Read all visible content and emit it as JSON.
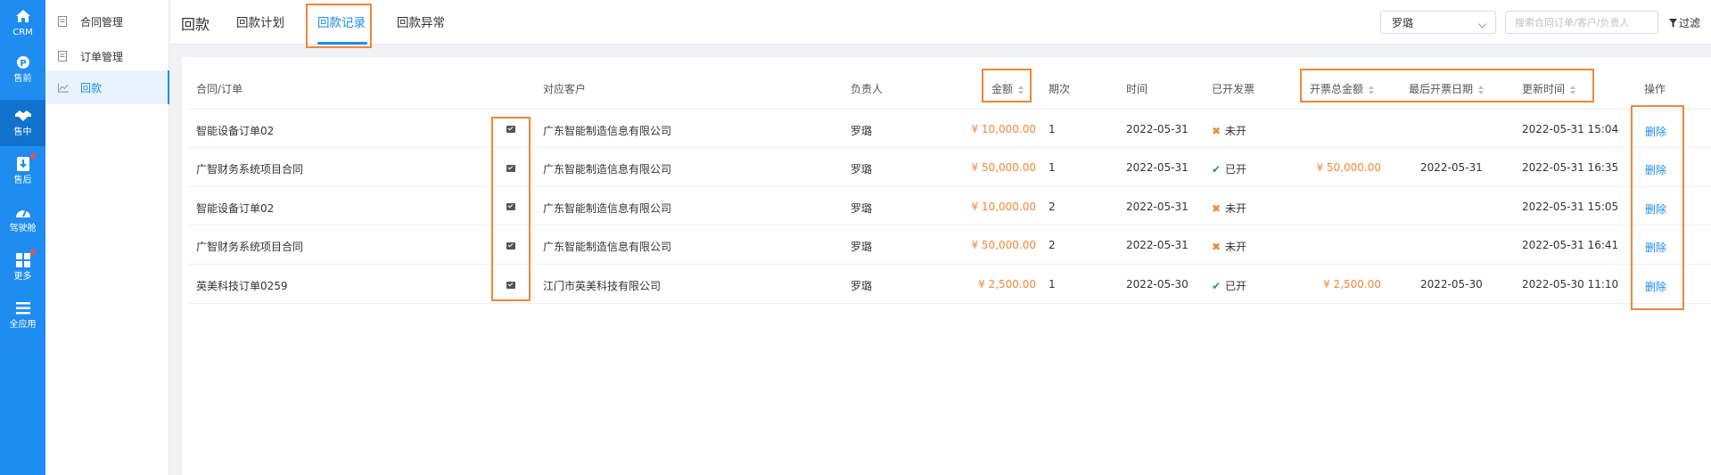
{
  "rail": [
    {
      "icon": "home-icon",
      "label": "CRM"
    },
    {
      "icon": "presale-icon",
      "label": "售前"
    },
    {
      "icon": "handshake-icon",
      "label": "售中"
    },
    {
      "icon": "aftersale-icon",
      "label": "售后"
    },
    {
      "icon": "dashboard-icon",
      "label": "驾驶舱"
    },
    {
      "icon": "grid-icon",
      "label": "更多"
    },
    {
      "icon": "menu-icon",
      "label": "全应用"
    }
  ],
  "submenu": [
    {
      "icon": "document-icon",
      "label": "合同管理"
    },
    {
      "icon": "document-icon",
      "label": "订单管理"
    },
    {
      "icon": "chart-line-icon",
      "label": "回款"
    }
  ],
  "header": {
    "title": "回款",
    "tabs": [
      "回款计划",
      "回款记录",
      "回款异常"
    ],
    "active_tab": "回款记录",
    "owner_select": "罗璐",
    "search_placeholder": "搜索合同订单/客户/负责人",
    "filter_label": "过滤"
  },
  "table": {
    "columns": {
      "contract": "合同/订单",
      "customer": "对应客户",
      "owner": "负责人",
      "amount": "金额",
      "period": "期次",
      "time": "时间",
      "invoiced": "已开发票",
      "invoice_total": "开票总金额",
      "last_invoice_date": "最后开票日期",
      "updated": "更新时间",
      "action": "操作"
    },
    "rows": [
      {
        "contract": "智能设备订单02",
        "customer": "广东智能制造信息有限公司",
        "owner": "罗璐",
        "amount": "¥ 10,000.00",
        "period": "1",
        "time": "2022-05-31",
        "invoiced": "未开",
        "invoice_total": "",
        "last_invoice_date": "",
        "updated": "2022-05-31 15:04",
        "action": "删除"
      },
      {
        "contract": "广智财务系统项目合同",
        "customer": "广东智能制造信息有限公司",
        "owner": "罗璐",
        "amount": "¥ 50,000.00",
        "period": "1",
        "time": "2022-05-31",
        "invoiced": "已开",
        "invoice_total": "¥ 50,000.00",
        "last_invoice_date": "2022-05-31",
        "updated": "2022-05-31 16:35",
        "action": "删除"
      },
      {
        "contract": "智能设备订单02",
        "customer": "广东智能制造信息有限公司",
        "owner": "罗璐",
        "amount": "¥ 10,000.00",
        "period": "2",
        "time": "2022-05-31",
        "invoiced": "未开",
        "invoice_total": "",
        "last_invoice_date": "",
        "updated": "2022-05-31 15:05",
        "action": "删除"
      },
      {
        "contract": "广智财务系统项目合同",
        "customer": "广东智能制造信息有限公司",
        "owner": "罗璐",
        "amount": "¥ 50,000.00",
        "period": "2",
        "time": "2022-05-31",
        "invoiced": "未开",
        "invoice_total": "",
        "last_invoice_date": "",
        "updated": "2022-05-31 16:41",
        "action": "删除"
      },
      {
        "contract": "英美科技订单0259",
        "customer": "江门市英美科技有限公司",
        "owner": "罗璐",
        "amount": "¥ 2,500.00",
        "period": "1",
        "time": "2022-05-30",
        "invoiced": "已开",
        "invoice_total": "¥ 2,500.00",
        "last_invoice_date": "2022-05-30",
        "updated": "2022-05-30 11:10",
        "action": "删除"
      }
    ]
  },
  "colors": {
    "accent": "#1e8cf0",
    "money": "#f0873a",
    "highlight": "#f0873a",
    "success": "#2a9d3c"
  }
}
